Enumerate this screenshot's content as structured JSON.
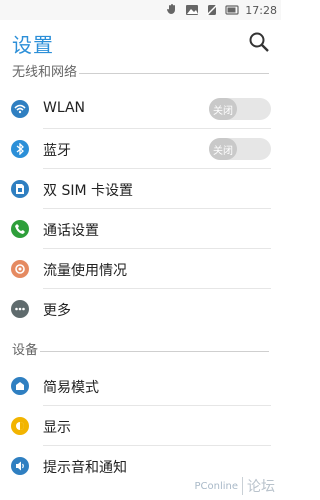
{
  "status_bar": {
    "time": "17:28",
    "icons": [
      "hand-notification-icon",
      "image-notification-icon",
      "silent-mode-icon",
      "battery-icon"
    ]
  },
  "app_bar": {
    "title": "设置",
    "search_icon": "search-icon"
  },
  "sections": [
    {
      "header": "无线和网络",
      "items": [
        {
          "label": "WLAN",
          "icon": "wifi-icon",
          "color": "#2f7fc1",
          "toggle": "关闭"
        },
        {
          "label": "蓝牙",
          "icon": "bluetooth-icon",
          "color": "#2b8fd8",
          "toggle": "关闭"
        },
        {
          "label": "双 SIM 卡设置",
          "icon": "sim-card-icon",
          "color": "#2f7fc1"
        },
        {
          "label": "通话设置",
          "icon": "phone-icon",
          "color": "#2e9f3a"
        },
        {
          "label": "流量使用情况",
          "icon": "data-usage-icon",
          "color": "#e58a61"
        },
        {
          "label": "更多",
          "icon": "more-icon",
          "color": "#5f6b6d"
        }
      ]
    },
    {
      "header": "设备",
      "items": [
        {
          "label": "简易模式",
          "icon": "easy-mode-icon",
          "color": "#2f7fc1"
        },
        {
          "label": "显示",
          "icon": "display-icon",
          "color": "#f2b400"
        },
        {
          "label": "提示音和通知",
          "icon": "sound-notification-icon",
          "color": "#2f7fc1"
        }
      ]
    }
  ],
  "watermark": {
    "brand": "PConline",
    "forum": "论坛"
  }
}
